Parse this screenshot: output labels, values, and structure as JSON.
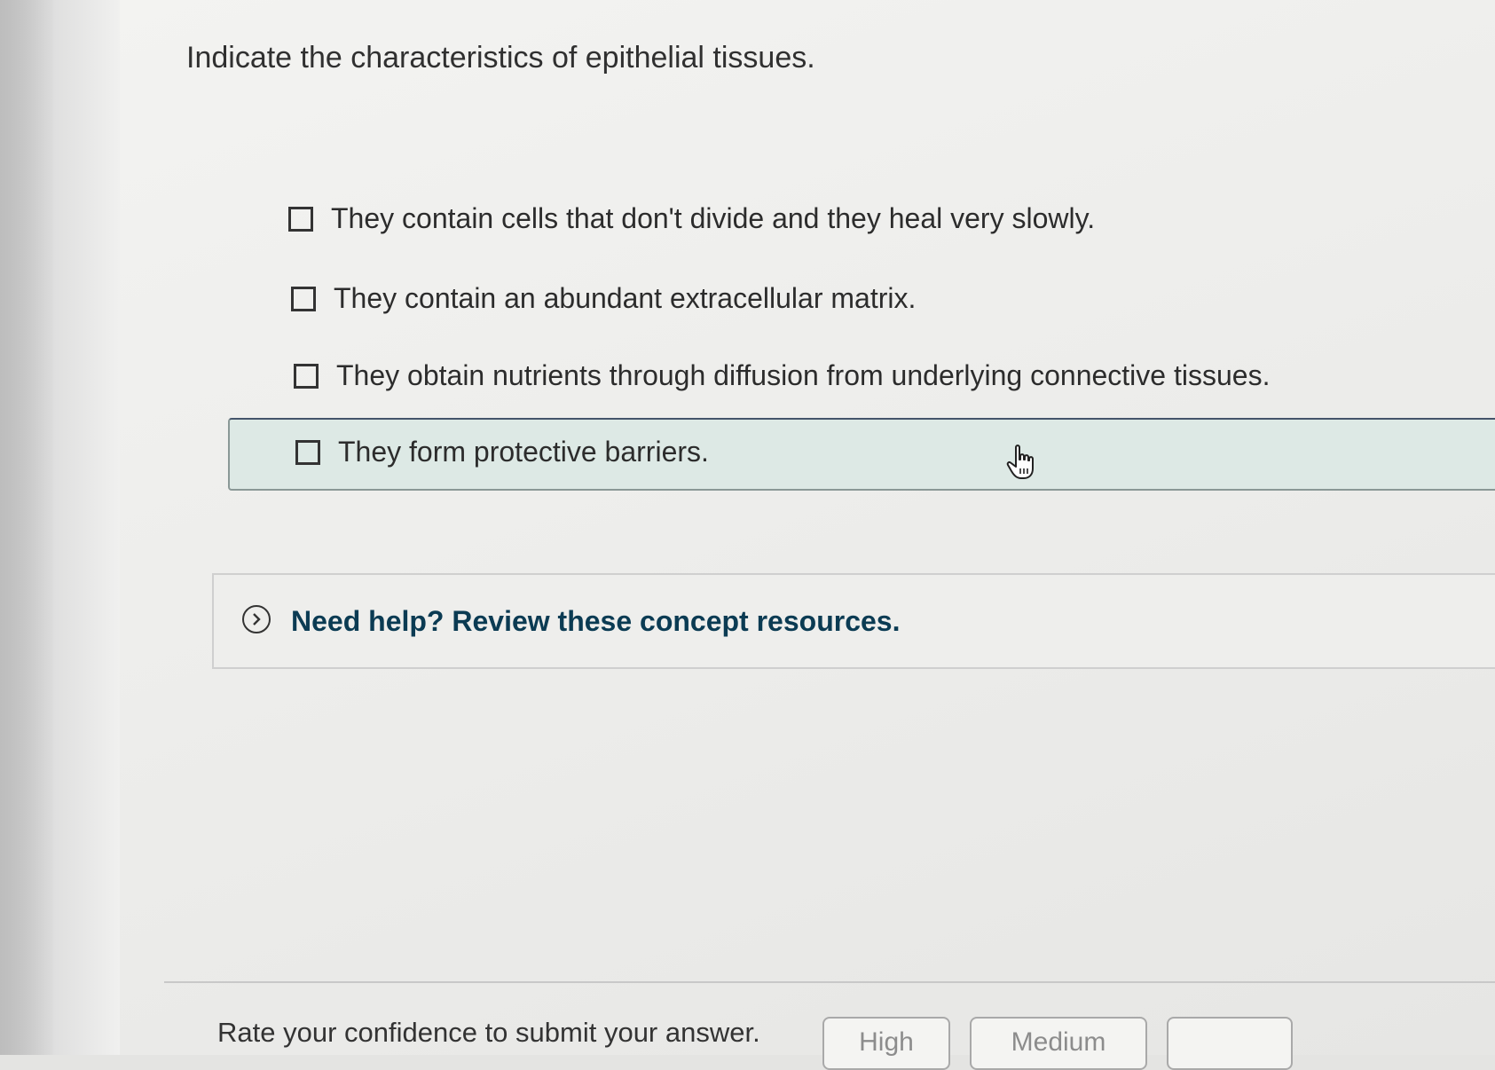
{
  "question": {
    "text": "Indicate the characteristics of epithelial tissues."
  },
  "options": [
    {
      "label": "They contain cells that don't divide and they heal very slowly.",
      "checked": false
    },
    {
      "label": "They contain an abundant extracellular matrix.",
      "checked": false
    },
    {
      "label": "They obtain nutrients through diffusion from underlying connective tissues.",
      "checked": false
    },
    {
      "label": "They form protective barriers.",
      "checked": false,
      "hovered": true
    }
  ],
  "help": {
    "text": "Need help? Review these concept resources.",
    "icon": "chevron-right-circle-icon"
  },
  "confidence": {
    "label": "Rate your confidence to submit your answer.",
    "buttons": {
      "high": "High",
      "medium": "Medium",
      "low": ""
    }
  },
  "colors": {
    "hover_row_bg": "#dde9e5",
    "help_text": "#0b3b53"
  }
}
